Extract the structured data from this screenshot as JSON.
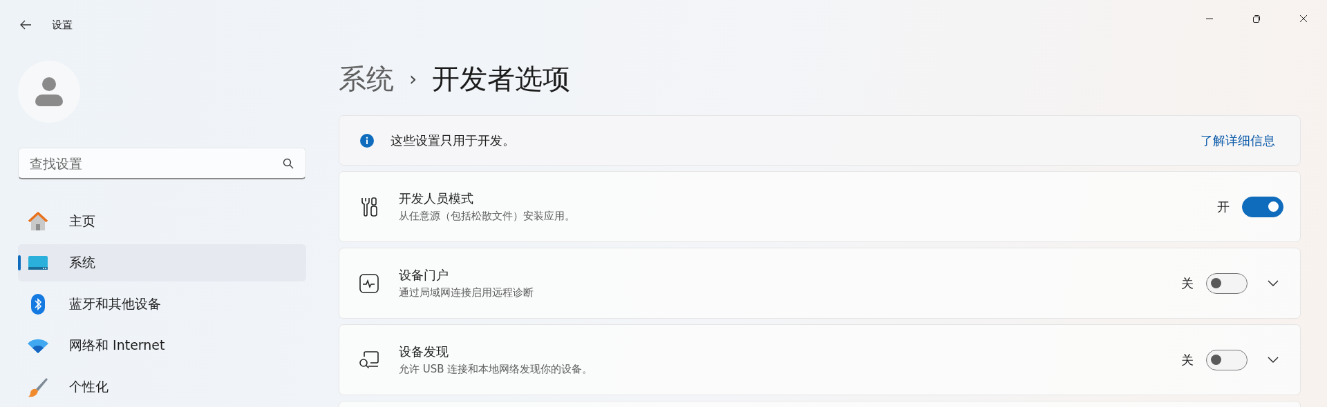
{
  "window": {
    "title": "设置"
  },
  "sidebar": {
    "search": {
      "placeholder": "查找设置"
    },
    "items": [
      {
        "label": "主页",
        "selected": false
      },
      {
        "label": "系统",
        "selected": true
      },
      {
        "label": "蓝牙和其他设备",
        "selected": false
      },
      {
        "label": "网络和 Internet",
        "selected": false
      },
      {
        "label": "个性化",
        "selected": false
      }
    ]
  },
  "breadcrumb": {
    "parent": "系统",
    "separator": "›",
    "current": "开发者选项"
  },
  "notice": {
    "text": "这些设置只用于开发。",
    "link": "了解详细信息"
  },
  "settings": [
    {
      "title": "开发人员模式",
      "description": "从任意源（包括松散文件）安装应用。",
      "state_label": "开",
      "on": true,
      "expandable": false
    },
    {
      "title": "设备门户",
      "description": "通过局域网连接启用远程诊断",
      "state_label": "关",
      "on": false,
      "expandable": true
    },
    {
      "title": "设备发现",
      "description": "允许 USB 连接和本地网络发现你的设备。",
      "state_label": "关",
      "on": false,
      "expandable": true
    }
  ]
}
